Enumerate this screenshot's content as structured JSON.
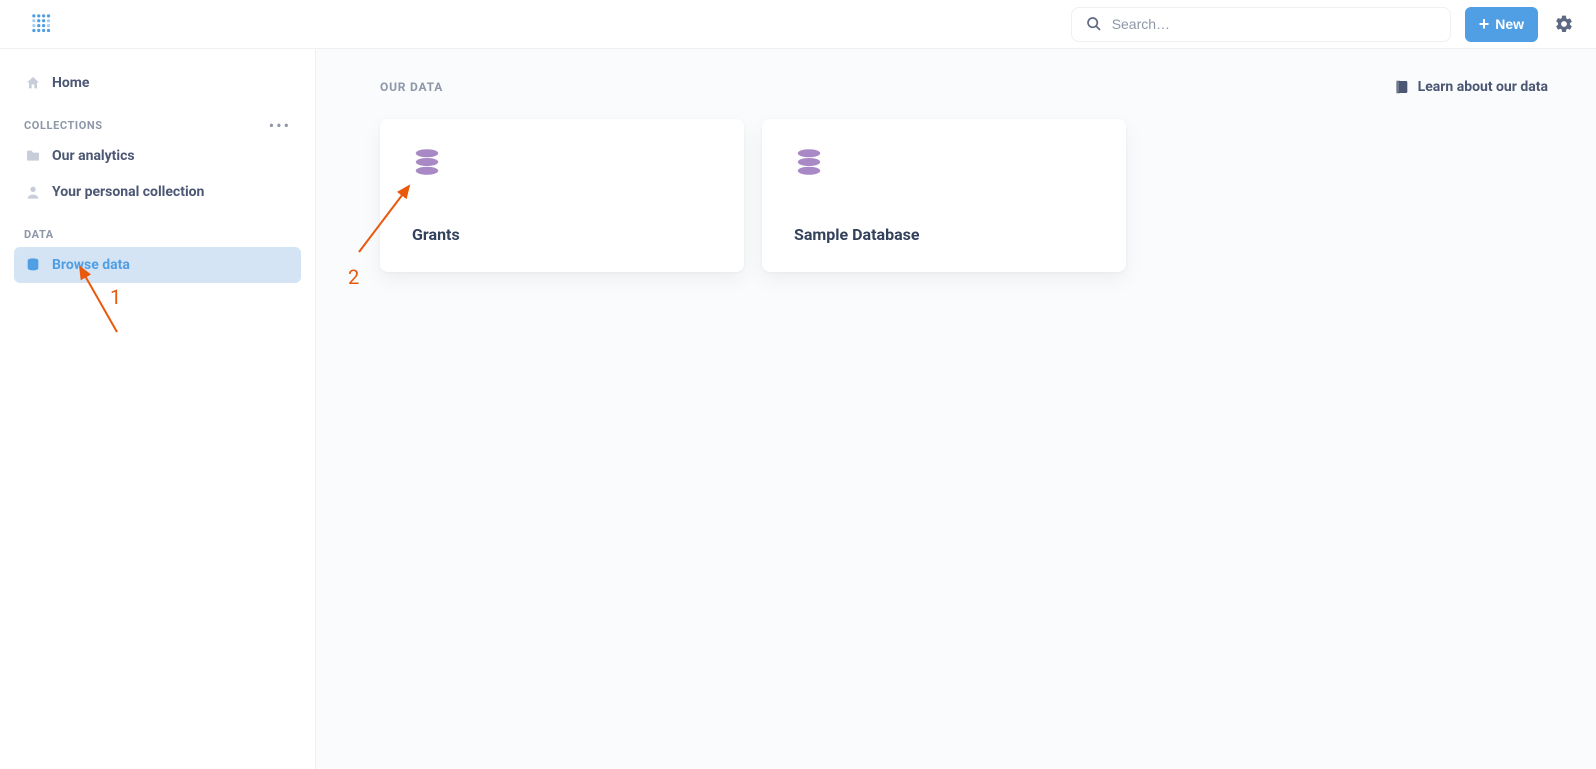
{
  "header": {
    "search_placeholder": "Search…",
    "new_label": "New"
  },
  "sidebar": {
    "home_label": "Home",
    "collections_label": "COLLECTIONS",
    "collections": [
      {
        "label": "Our analytics"
      },
      {
        "label": "Your personal collection"
      }
    ],
    "data_label": "DATA",
    "browse_label": "Browse data"
  },
  "main": {
    "title": "OUR DATA",
    "learn_label": "Learn about our data",
    "databases": [
      {
        "name": "Grants"
      },
      {
        "name": "Sample Database"
      }
    ]
  },
  "annotations": {
    "arrow1_label": "1",
    "arrow2_label": "2"
  },
  "colors": {
    "brand": "#509ee3",
    "purple": "#a989c5",
    "text": "#4c5773",
    "muted": "#8d97a8",
    "annotation": "#e8590c"
  }
}
